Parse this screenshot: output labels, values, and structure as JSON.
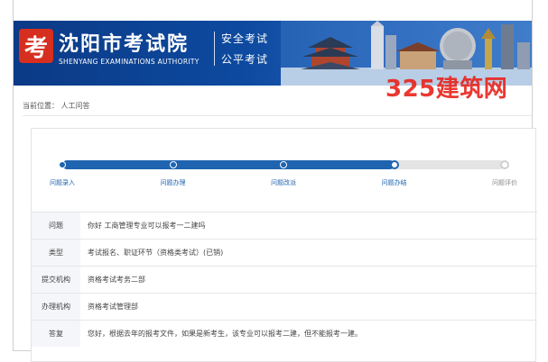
{
  "header": {
    "logo_char": "考",
    "org_name_cn": "沈阳市考试院",
    "org_name_en": "SHENYANG EXAMINATIONS AUTHORITY",
    "slogan_line1": "安全考试",
    "slogan_line2": "公平考试"
  },
  "watermark": "325建筑网",
  "breadcrumb": "当前位置： 人工问答",
  "progress": {
    "steps": [
      {
        "label": "问题录入",
        "state": "done"
      },
      {
        "label": "问题办理",
        "state": "done"
      },
      {
        "label": "问题改派",
        "state": "done"
      },
      {
        "label": "问题办结",
        "state": "current"
      },
      {
        "label": "问题评价",
        "state": "pending"
      }
    ],
    "completed_fraction": 0.75,
    "colors": {
      "active": "#1f64b0",
      "inactive": "#e4e4e4"
    }
  },
  "details": [
    {
      "key": "问题",
      "value": "你好 工商管理专业可以报考一二建吗"
    },
    {
      "key": "类型",
      "value": "考试报名、职证环节（资格类考试）(已销)"
    },
    {
      "key": "提交机构",
      "value": "资格考试考务二部"
    },
    {
      "key": "办理机构",
      "value": "资格考试管理部"
    },
    {
      "key": "答复",
      "value": "您好，根据去年的报考文件，如果是新考生，该专业可以报考二建，但不能报考一建。"
    }
  ]
}
